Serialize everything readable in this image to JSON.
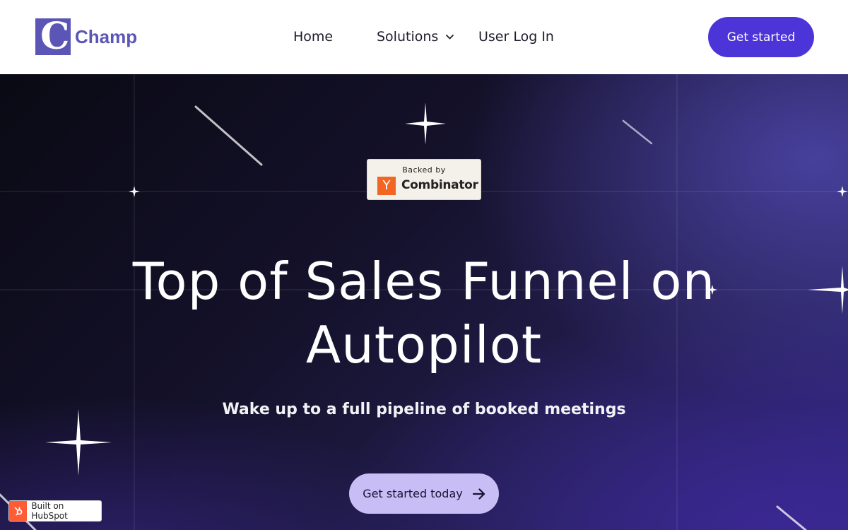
{
  "header": {
    "logo_letter": "C",
    "logo_text": "Champ",
    "nav": {
      "home": "Home",
      "solutions": "Solutions",
      "login": "User Log In"
    },
    "cta": "Get started"
  },
  "hero": {
    "badge": {
      "top": "Backed by",
      "letter": "Y",
      "name": "Combinator"
    },
    "title_line1": "Top of Sales Funnel on",
    "title_line2": "Autopilot",
    "subtitle": "Wake up to a full pipeline of booked meetings",
    "cta": "Get started today"
  },
  "footer_badge": {
    "text": "Built on HubSpot"
  },
  "colors": {
    "brand": "#5b55b5",
    "primary_button": "#4b35d8",
    "hero_button": "#c8bdf5",
    "ycombinator": "#f26522",
    "hubspot": "#ff5c35"
  },
  "icons": [
    "chevron-down-icon",
    "arrow-right-icon",
    "hubspot-sprocket-icon",
    "sparkle-star-icon",
    "shooting-star-icon"
  ]
}
